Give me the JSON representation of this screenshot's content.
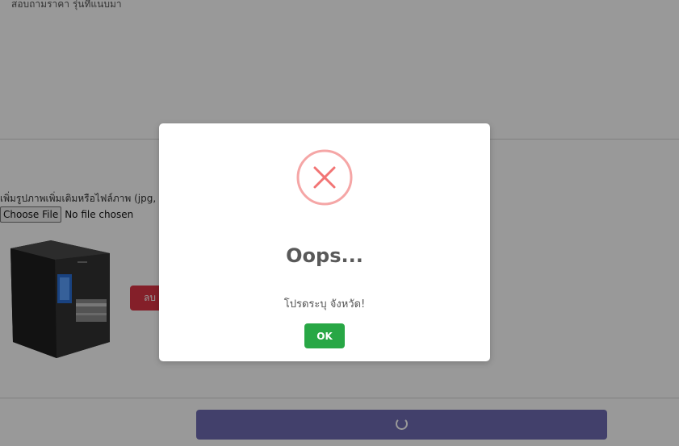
{
  "page": {
    "top_text": "สอบถามราคา รุ่นที่แนบมา",
    "upload_label": "เพิ่มรูปภาพเพิ่มเติมหรือไฟล์ภาพ (jpg, png)",
    "file_button_label": "Choose File",
    "file_status": "No file chosen",
    "delete_button_label": "ลบ"
  },
  "dialog": {
    "icon": "error-x-icon",
    "title": "Oops...",
    "message": "โปรดระบุ จังหวัด!",
    "ok_label": "OK",
    "error_color": "#f27474",
    "ok_color": "#28a745"
  },
  "colors": {
    "submit_button": "#6f6cb3",
    "delete_button": "#dc3545"
  }
}
